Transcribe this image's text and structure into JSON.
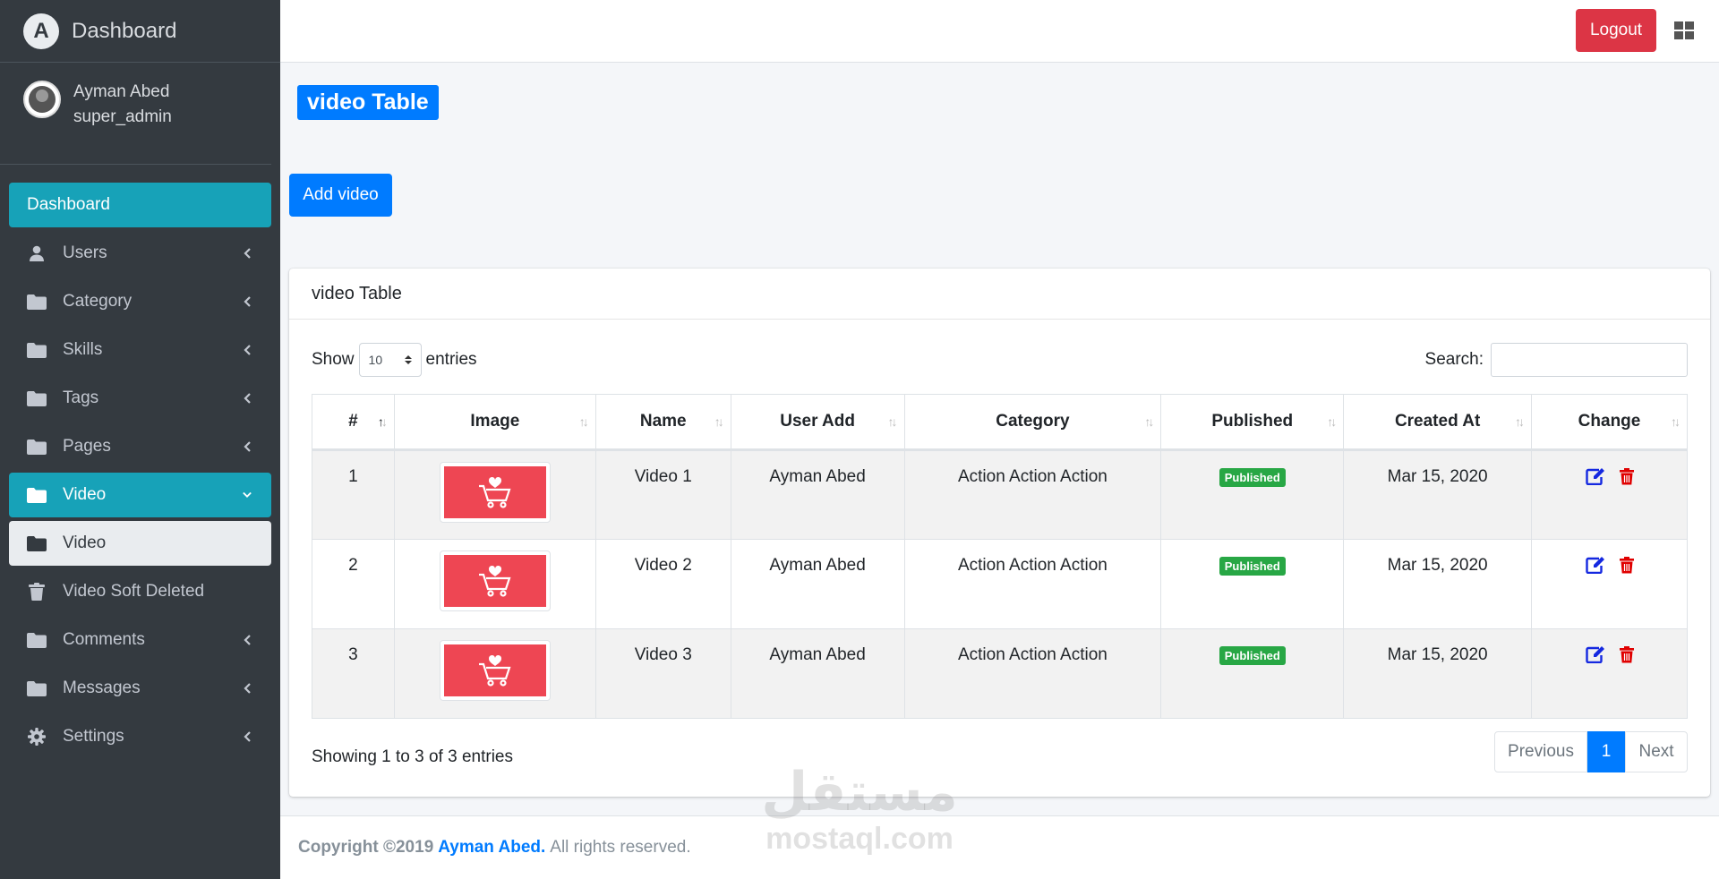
{
  "brand": {
    "title": "Dashboard",
    "logo_letter": "A"
  },
  "user": {
    "name": "Ayman Abed",
    "role": "super_admin"
  },
  "sidebar": {
    "items": [
      {
        "label": "Dashboard",
        "icon": "none",
        "state": "active"
      },
      {
        "label": "Users",
        "icon": "user-icon"
      },
      {
        "label": "Category",
        "icon": "folder-icon"
      },
      {
        "label": "Skills",
        "icon": "folder-icon"
      },
      {
        "label": "Tags",
        "icon": "folder-icon"
      },
      {
        "label": "Pages",
        "icon": "folder-icon"
      },
      {
        "label": "Video",
        "icon": "folder-icon",
        "state": "active-open"
      },
      {
        "label": "Video",
        "icon": "folder-icon",
        "state": "sub-active"
      },
      {
        "label": "Video Soft Deleted",
        "icon": "trash-icon"
      },
      {
        "label": "Comments",
        "icon": "folder-icon"
      },
      {
        "label": "Messages",
        "icon": "folder-icon"
      },
      {
        "label": "Settings",
        "icon": "gear-icon"
      }
    ]
  },
  "topbar": {
    "logout_label": "Logout",
    "grid_icon": "grid-icon"
  },
  "page": {
    "title": "video Table",
    "add_label": "Add video"
  },
  "card": {
    "title": "video Table",
    "show_label": "Show",
    "entries_label": "entries",
    "page_size": "10",
    "search_label": "Search:",
    "search_value": ""
  },
  "table": {
    "columns": [
      "#",
      "Image",
      "Name",
      "User Add",
      "Category",
      "Published",
      "Created At",
      "Change"
    ],
    "rows": [
      {
        "id": "1",
        "name": "Video 1",
        "user": "Ayman Abed",
        "category": "Action Action Action",
        "status": "Published",
        "created": "Mar 15, 2020"
      },
      {
        "id": "2",
        "name": "Video 2",
        "user": "Ayman Abed",
        "category": "Action Action Action",
        "status": "Published",
        "created": "Mar 15, 2020"
      },
      {
        "id": "3",
        "name": "Video 3",
        "user": "Ayman Abed",
        "category": "Action Action Action",
        "status": "Published",
        "created": "Mar 15, 2020"
      }
    ]
  },
  "pagination": {
    "info": "Showing 1 to 3 of 3 entries",
    "previous": "Previous",
    "current": "1",
    "next": "Next"
  },
  "footer": {
    "copyright": "Copyright ©2019",
    "author": "Ayman Abed.",
    "rights": "All rights reserved."
  },
  "watermark": {
    "arabic": "مستقل",
    "latin": "mostaql.com"
  },
  "colors": {
    "sidebar": "#343a40",
    "active": "#17a2b8",
    "primary": "#007bff",
    "danger": "#dc3545",
    "success": "#28a745"
  }
}
